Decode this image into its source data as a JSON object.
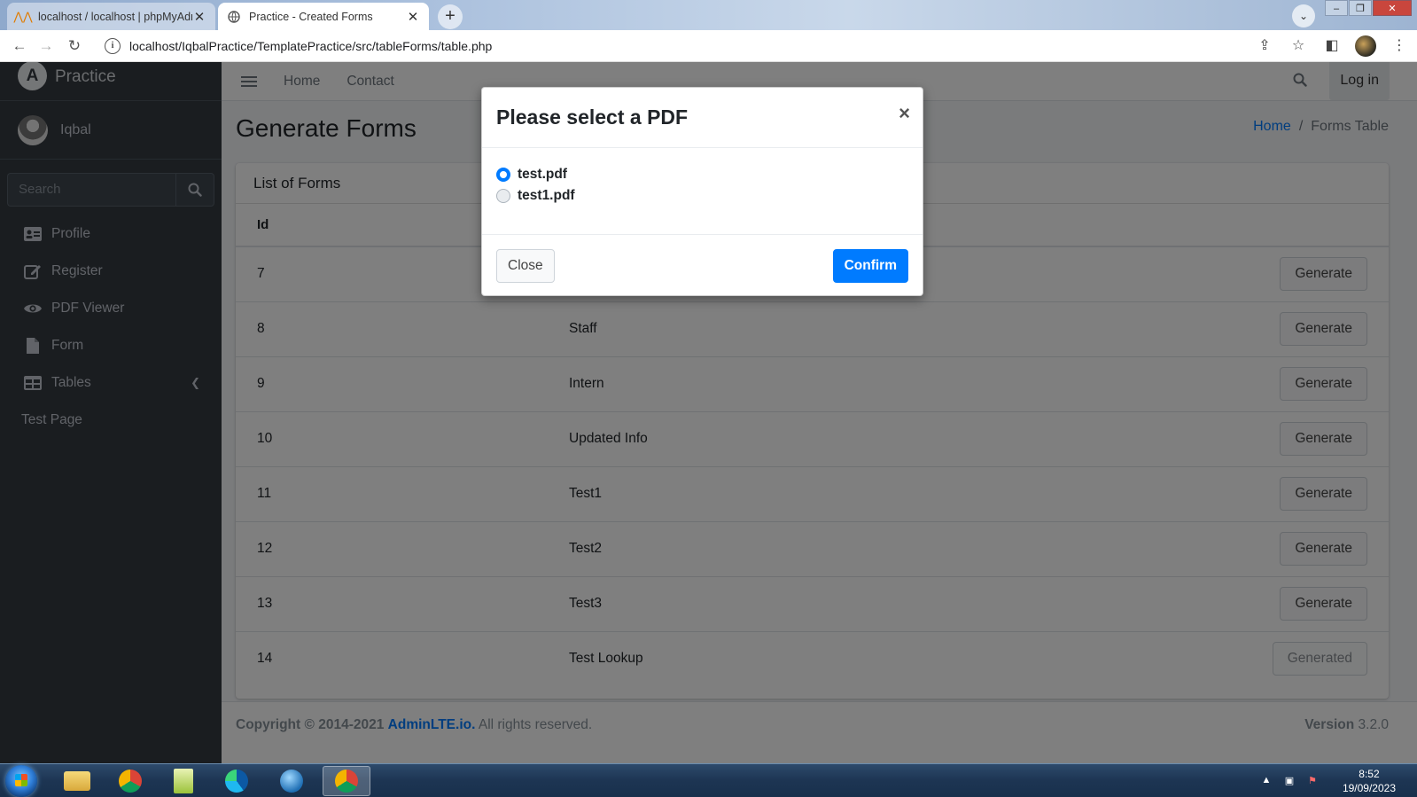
{
  "browser": {
    "tabs": [
      {
        "title": "localhost / localhost | phpMyAdmin",
        "active": false
      },
      {
        "title": "Practice - Created Forms",
        "active": true
      }
    ],
    "url": "localhost/IqbalPractice/TemplatePractice/src/tableForms/table.php"
  },
  "sidebar": {
    "brand": "Practice",
    "user": "Iqbal",
    "search_placeholder": "Search",
    "items": [
      {
        "label": "Profile",
        "icon": "id-card-icon"
      },
      {
        "label": "Register",
        "icon": "edit-icon"
      },
      {
        "label": "PDF Viewer",
        "icon": "eye-icon"
      },
      {
        "label": "Form",
        "icon": "file-icon"
      },
      {
        "label": "Tables",
        "icon": "table-icon"
      }
    ],
    "header_item": "Test Page"
  },
  "topnav": {
    "links": [
      "Home",
      "Contact"
    ],
    "login": "Log in"
  },
  "content": {
    "title": "Generate Forms",
    "breadcrumb": {
      "home": "Home",
      "current": "Forms Table"
    },
    "card_title": "List of Forms",
    "table": {
      "headers": [
        "Id",
        "",
        ""
      ],
      "rows": [
        {
          "id": "7",
          "name": "",
          "action": "Generate"
        },
        {
          "id": "8",
          "name": "Staff",
          "action": "Generate"
        },
        {
          "id": "9",
          "name": "Intern",
          "action": "Generate"
        },
        {
          "id": "10",
          "name": "Updated Info",
          "action": "Generate"
        },
        {
          "id": "11",
          "name": "Test1",
          "action": "Generate"
        },
        {
          "id": "12",
          "name": "Test2",
          "action": "Generate"
        },
        {
          "id": "13",
          "name": "Test3",
          "action": "Generate"
        },
        {
          "id": "14",
          "name": "Test Lookup",
          "action": "Generated"
        }
      ]
    }
  },
  "footer": {
    "copyright": "Copyright © 2014-2021",
    "link": "AdminLTE.io.",
    "rights": "All rights reserved.",
    "version_label": "Version",
    "version": "3.2.0"
  },
  "modal": {
    "title": "Please select a PDF",
    "close_x": "×",
    "options": [
      {
        "label": "test.pdf",
        "checked": true
      },
      {
        "label": "test1.pdf",
        "checked": false
      }
    ],
    "close_button": "Close",
    "confirm_button": "Confirm"
  },
  "taskbar": {
    "time": "8:52",
    "date": "19/09/2023"
  },
  "colors": {
    "primary": "#007bff",
    "sidebar": "#343a40"
  }
}
